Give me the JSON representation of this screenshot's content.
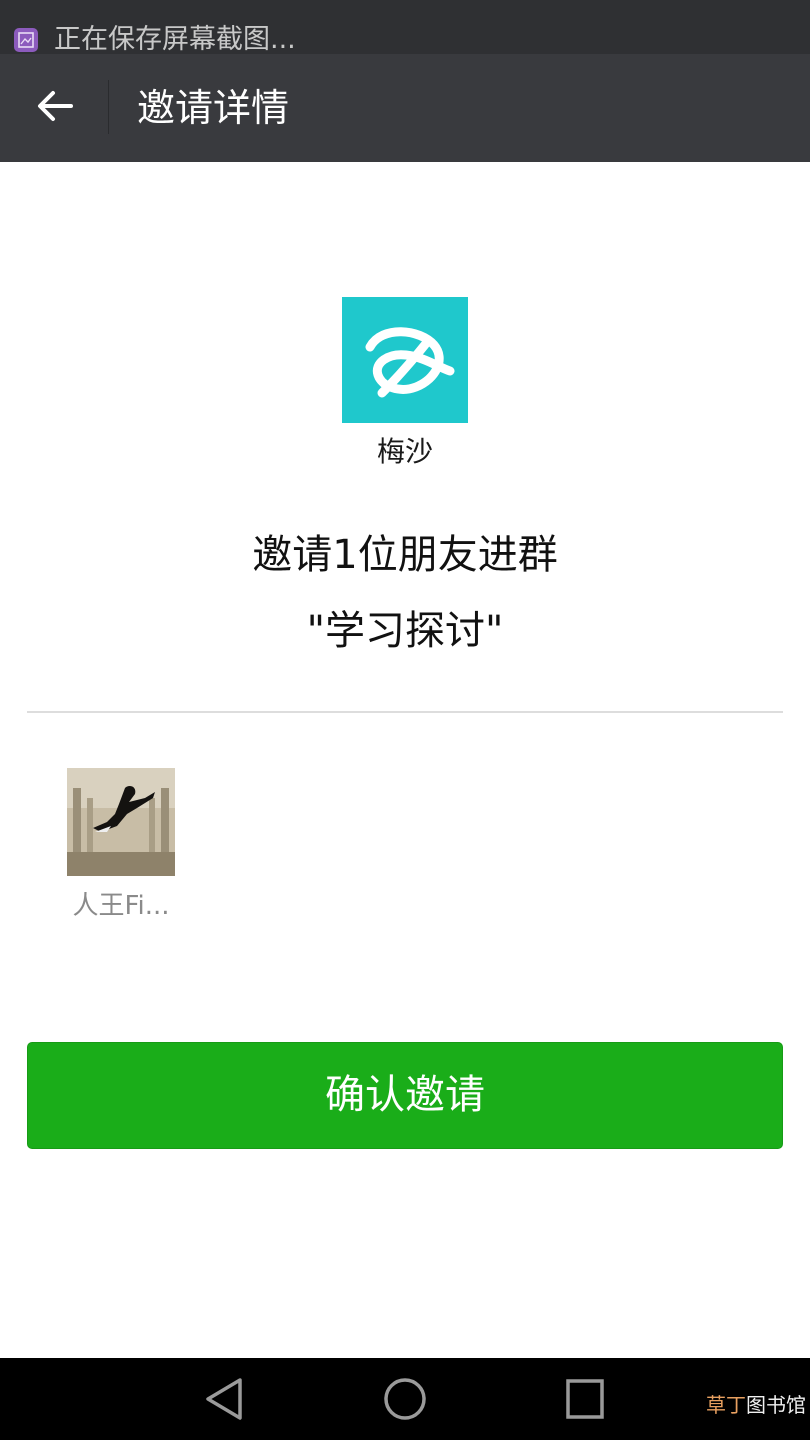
{
  "status_bar": {
    "notification_text": "正在保存屏幕截图...",
    "icon": "screenshot-icon"
  },
  "nav": {
    "back_icon": "back-arrow-icon",
    "title": "邀请详情"
  },
  "invite": {
    "group_avatar_icon": "knot-logo-icon",
    "group_avatar_color": "#1fc8cc",
    "inviter_name": "梅沙",
    "message_line1": "邀请1位朋友进群",
    "message_line2": "\"学习探讨\""
  },
  "members": [
    {
      "name": "人王Fi...",
      "avatar": "photo-avatar"
    }
  ],
  "confirm": {
    "label": "确认邀请",
    "color": "#1aad19"
  },
  "system_nav": {
    "back": "triangle-back-icon",
    "home": "circle-home-icon",
    "recents": "square-recents-icon"
  },
  "watermark": {
    "highlight": "草丁",
    "rest": "图书馆"
  }
}
